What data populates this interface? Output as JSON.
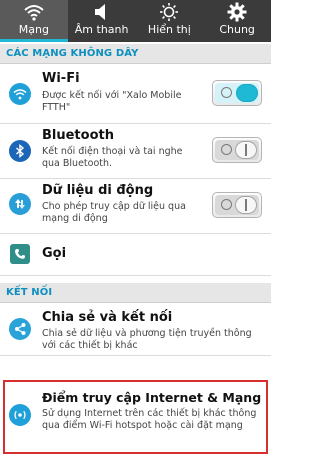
{
  "tabs": [
    {
      "label": "Mạng",
      "icon": "wifi-icon",
      "active": true
    },
    {
      "label": "Âm thanh",
      "icon": "speaker-icon",
      "active": false
    },
    {
      "label": "Hiển thị",
      "icon": "brightness-icon",
      "active": false
    },
    {
      "label": "Chung",
      "icon": "gear-icon",
      "active": false
    }
  ],
  "sections": {
    "wireless": "CÁC MẠNG KHÔNG DÂY",
    "connect": "KẾT NỐI"
  },
  "rows": {
    "wifi": {
      "title": "Wi-Fi",
      "sub1": "Được kết nối với \"Xalo Mobile",
      "sub2": "FTTH\"",
      "icon": "wifi-icon",
      "toggle": "on"
    },
    "bluetooth": {
      "title": "Bluetooth",
      "sub1": "Kết nối điện thoại và tai nghe",
      "sub2": "qua Bluetooth.",
      "icon": "bluetooth-icon",
      "toggle": "off"
    },
    "mobile_data": {
      "title": "Dữ liệu di động",
      "sub1": "Cho phép truy cập dữ liệu qua",
      "sub2": "mạng di động",
      "icon": "mobile-data-icon",
      "toggle": "off"
    },
    "call": {
      "title": "Gọi",
      "icon": "phone-icon"
    },
    "share": {
      "title": "Chia sẻ và kết nối",
      "sub1": "Chia sẻ dữ liệu và phương tiện truyền thông",
      "sub2": "với các thiết bị khác",
      "icon": "share-icon"
    },
    "hotspot": {
      "title": "Điểm truy cập Internet & Mạng",
      "sub1": "Sử dụng Internet trên các thiết bị khác thông",
      "sub2": "qua điểm Wi-Fi hotspot hoặc cài đặt mạng",
      "icon": "hotspot-icon"
    }
  },
  "colors": {
    "accent": "#1fb9d6",
    "section_text": "#0d8fbf",
    "tabbar": "#3b3b3b",
    "highlight": "#d62f2f"
  }
}
